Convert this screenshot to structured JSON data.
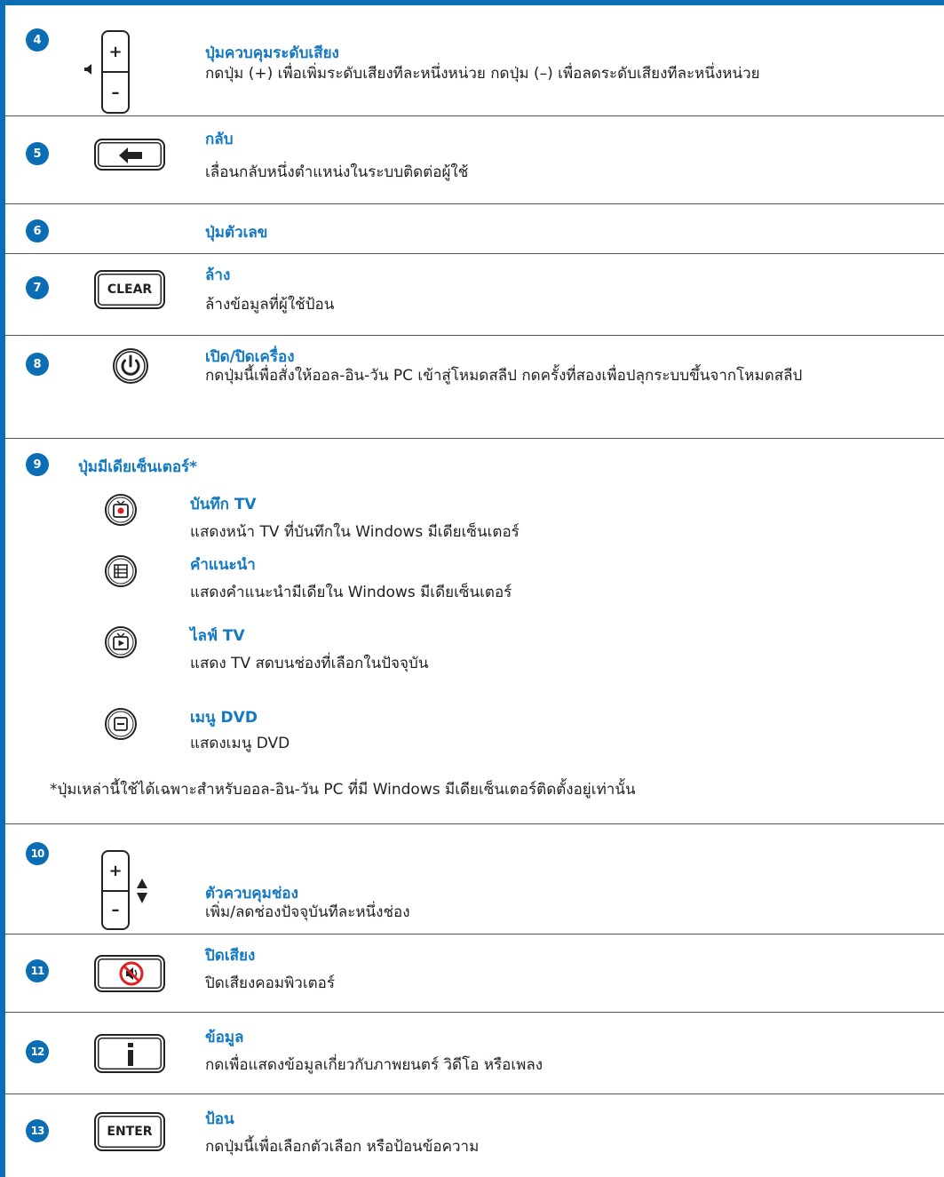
{
  "colors": {
    "accent": "#0b6db4",
    "heading": "#1379c2",
    "text": "#231f20"
  },
  "items": {
    "volume": {
      "num": "4",
      "title": "ปุ่มควบคุมระดับเสียง",
      "desc": "กดปุ่ม (+) เพื่อเพิ่มระดับเสียงทีละหนึ่งหน่วย กดปุ่ม (–) เพื่อลดระดับเสียงทีละหนึ่งหน่วย",
      "plus": "+",
      "minus": "–"
    },
    "back": {
      "num": "5",
      "title": "กลับ",
      "desc": "เลื่อนกลับหนึ่งตำแหน่งในระบบติดต่อผู้ใช้"
    },
    "numeric": {
      "num": "6",
      "title": "ปุ่มตัวเลข"
    },
    "clear": {
      "num": "7",
      "title": "ล้าง",
      "desc": "ล้างข้อมูลที่ผู้ใช้ป้อน",
      "key": "CLEAR"
    },
    "power": {
      "num": "8",
      "title": "เปิด/ปิดเครื่อง",
      "desc": "กดปุ่มนี้เพื่อสั่งให้ออล-อิน-วัน PC เข้าสู่โหมดสลีป กดครั้งที่สองเพื่อปลุกระบบขึ้นจากโหมดสลีป"
    },
    "media_center": {
      "num": "9",
      "title": "ปุ่มมีเดียเซ็นเตอร์*",
      "subitems": [
        {
          "title": "บันทึก TV",
          "desc": "แสดงหน้า TV ที่บันทึกใน Windows มีเดียเซ็นเตอร์",
          "icon": "recorded-tv-icon"
        },
        {
          "title": "คำแนะนำ",
          "desc": "แสดงคำแนะนำมีเดียใน Windows มีเดียเซ็นเตอร์",
          "icon": "guide-icon"
        },
        {
          "title": "ไลฟ์ TV",
          "desc": "แสดง TV สดบนช่องที่เลือกในปัจจุบัน",
          "icon": "live-tv-icon"
        },
        {
          "title": "เมนู DVD",
          "desc": "แสดงเมนู DVD",
          "icon": "dvd-menu-icon"
        }
      ],
      "footnote": "*ปุ่มเหล่านี้ใช้ได้เฉพาะสำหรับออล-อิน-วัน PC ที่มี Windows มีเดียเซ็นเตอร์ติดตั้งอยู่เท่านั้น"
    },
    "channel": {
      "num": "10",
      "title": "ตัวควบคุมช่อง",
      "desc": "เพิ่ม/ลดช่องปัจจุบันทีละหนึ่งช่อง",
      "plus": "+",
      "minus": "–"
    },
    "mute": {
      "num": "11",
      "title": "ปิดเสียง",
      "desc": "ปิดเสียงคอมพิวเตอร์"
    },
    "info": {
      "num": "12",
      "title": "ข้อมูล",
      "desc": "กดเพื่อแสดงข้อมูลเกี่ยวกับภาพยนตร์ วิดีโอ หรือเพลง"
    },
    "enter": {
      "num": "13",
      "title": "ป้อน",
      "desc": "กดปุ่มนี้เพื่อเลือกตัวเลือก หรือป้อนข้อความ",
      "key": "ENTER"
    }
  }
}
